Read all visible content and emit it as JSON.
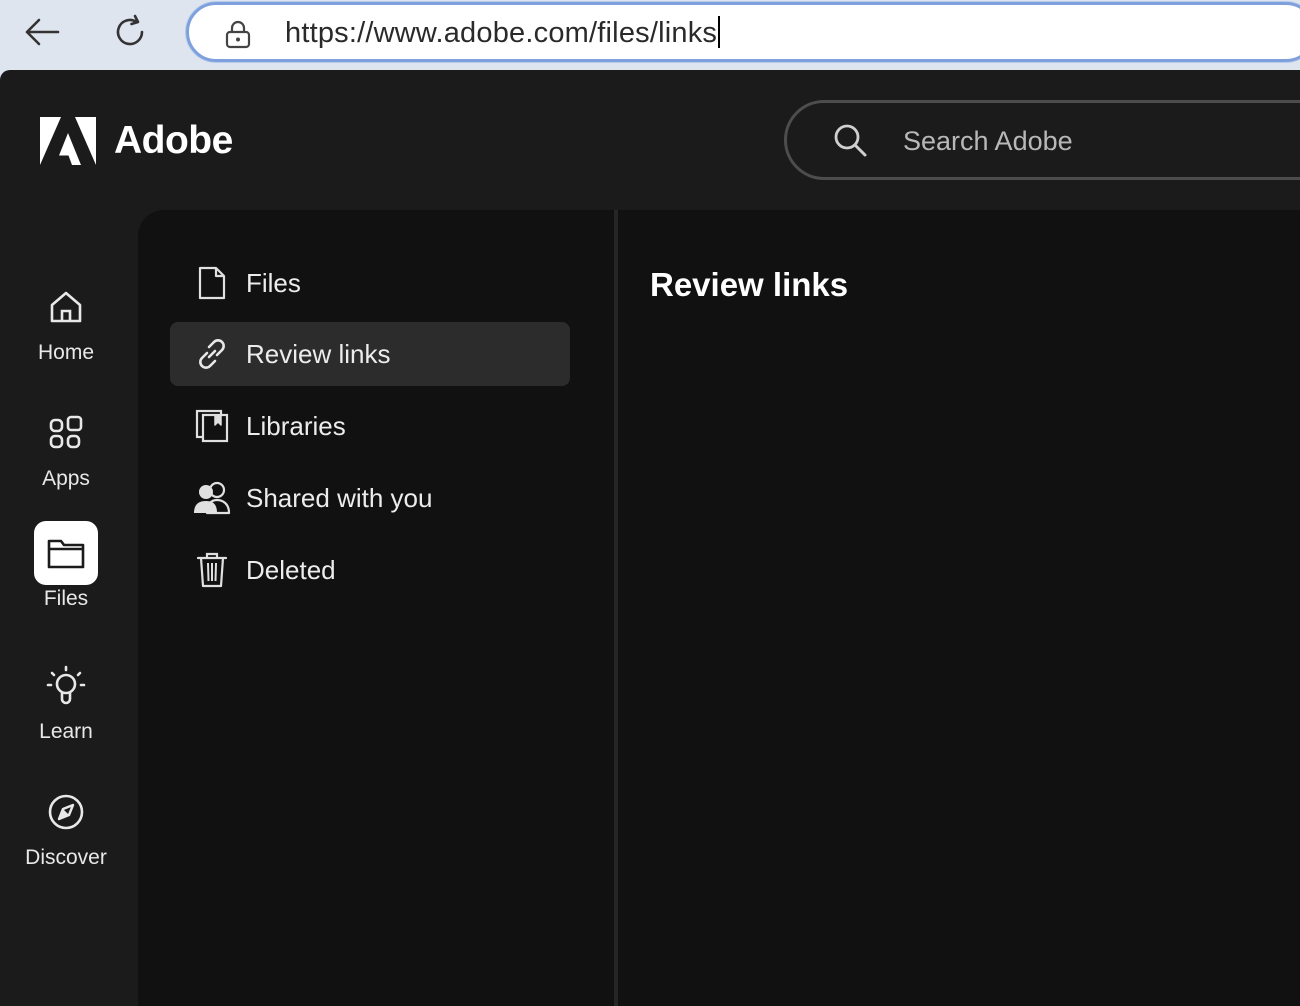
{
  "browser": {
    "url": "https://www.adobe.com/files/links"
  },
  "header": {
    "brand": "Adobe",
    "search_placeholder": "Search Adobe"
  },
  "rail": {
    "items": [
      {
        "label": "Home",
        "icon": "home-icon"
      },
      {
        "label": "Apps",
        "icon": "apps-icon"
      },
      {
        "label": "Files",
        "icon": "folder-icon",
        "active": true
      },
      {
        "label": "Learn",
        "icon": "lightbulb-icon"
      },
      {
        "label": "Discover",
        "icon": "compass-icon"
      }
    ]
  },
  "sidebar": {
    "items": [
      {
        "label": "Files",
        "icon": "document-icon"
      },
      {
        "label": "Review links",
        "icon": "link-icon",
        "active": true
      },
      {
        "label": "Libraries",
        "icon": "library-icon"
      },
      {
        "label": "Shared with you",
        "icon": "people-icon"
      },
      {
        "label": "Deleted",
        "icon": "trash-icon"
      }
    ]
  },
  "main": {
    "title": "Review links"
  },
  "colors": {
    "app_bg": "#1b1b1b",
    "panel_bg": "#111111",
    "active_item_bg": "#2c2c2c",
    "browser_bg": "#dfe5ee",
    "address_border": "#7ea1de"
  }
}
